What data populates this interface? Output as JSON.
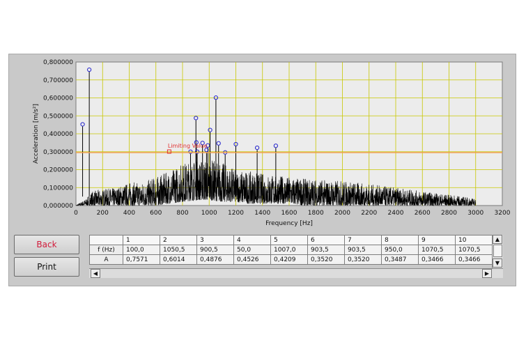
{
  "chart_data": {
    "type": "line",
    "xlabel": "Frequency [Hz]",
    "ylabel": "Acceleration [m/s²]",
    "xlim": [
      0,
      3200
    ],
    "ylim": [
      0,
      0.8
    ],
    "x_ticks": [
      "0",
      "200",
      "400",
      "600",
      "800",
      "1000",
      "1200",
      "1400",
      "1600",
      "1800",
      "2000",
      "2200",
      "2400",
      "2600",
      "2800",
      "3000",
      "3200"
    ],
    "y_ticks": [
      "0,000000",
      "0,100000",
      "0,200000",
      "0,300000",
      "0,400000",
      "0,500000",
      "0,600000",
      "0,700000",
      "0,800000"
    ],
    "grid": true,
    "colors": {
      "plot_bg": "#ececec",
      "grid": "#c8c800",
      "signal": "#000000",
      "limit": "#f0a050",
      "peak": "#2222cc",
      "annotation": "#e03030"
    },
    "limiting_value": {
      "label": "Limiting Value",
      "y": 0.295,
      "x_label": 700
    },
    "spectrum_envelope": {
      "x": [
        0,
        40,
        80,
        120,
        200,
        300,
        400,
        500,
        600,
        700,
        800,
        900,
        1000,
        1100,
        1200,
        1300,
        1400,
        1500,
        1600,
        1700,
        1800,
        1900,
        2000,
        2100,
        2200,
        2300,
        2400,
        2500,
        2600,
        2700,
        2800,
        2900,
        3000
      ],
      "y_max": [
        0.0,
        0.02,
        0.04,
        0.08,
        0.09,
        0.1,
        0.13,
        0.13,
        0.16,
        0.19,
        0.24,
        0.25,
        0.26,
        0.24,
        0.2,
        0.19,
        0.18,
        0.17,
        0.16,
        0.15,
        0.15,
        0.14,
        0.14,
        0.13,
        0.12,
        0.11,
        0.1,
        0.09,
        0.08,
        0.07,
        0.06,
        0.05,
        0.04
      ],
      "y_min": [
        0.0,
        0.0,
        0.0,
        0.0,
        0.0,
        0.0,
        0.0,
        0.0,
        0.0,
        0.01,
        0.02,
        0.03,
        0.03,
        0.02,
        0.02,
        0.01,
        0.01,
        0.01,
        0.01,
        0.0,
        0.0,
        0.0,
        0.0,
        0.0,
        0.0,
        0.0,
        0.0,
        0.0,
        0.0,
        0.0,
        0.0,
        0.0,
        0.0
      ]
    },
    "peaks": [
      {
        "x": 50.0,
        "y": 0.4526
      },
      {
        "x": 100.0,
        "y": 0.7571
      },
      {
        "x": 860.0,
        "y": 0.3
      },
      {
        "x": 900.5,
        "y": 0.4876
      },
      {
        "x": 903.5,
        "y": 0.352
      },
      {
        "x": 910.0,
        "y": 0.3
      },
      {
        "x": 950.0,
        "y": 0.3487
      },
      {
        "x": 980.0,
        "y": 0.31
      },
      {
        "x": 990.0,
        "y": 0.335
      },
      {
        "x": 1007.0,
        "y": 0.4209
      },
      {
        "x": 1050.5,
        "y": 0.6014
      },
      {
        "x": 1070.5,
        "y": 0.3466
      },
      {
        "x": 1120.0,
        "y": 0.296
      },
      {
        "x": 1200.0,
        "y": 0.342
      },
      {
        "x": 1360.0,
        "y": 0.322
      },
      {
        "x": 1500.0,
        "y": 0.333
      }
    ]
  },
  "buttons": {
    "back": "Back",
    "print": "Print"
  },
  "table": {
    "corner": "",
    "columns": [
      "1",
      "2",
      "3",
      "4",
      "5",
      "6",
      "7",
      "8",
      "9",
      "10"
    ],
    "rows": [
      {
        "label": "f  (Hz)",
        "values": [
          "100,0",
          "1050,5",
          "900,5",
          "50,0",
          "1007,0",
          "903,5",
          "903,5",
          "950,0",
          "1070,5",
          "1070,5"
        ]
      },
      {
        "label": "A",
        "values": [
          "0,7571",
          "0,6014",
          "0,4876",
          "0,4526",
          "0,4209",
          "0,3520",
          "0,3520",
          "0,3487",
          "0,3466",
          "0,3466"
        ]
      }
    ]
  },
  "scroll": {
    "up": "▲",
    "down": "▼",
    "left": "◀",
    "right": "▶"
  }
}
